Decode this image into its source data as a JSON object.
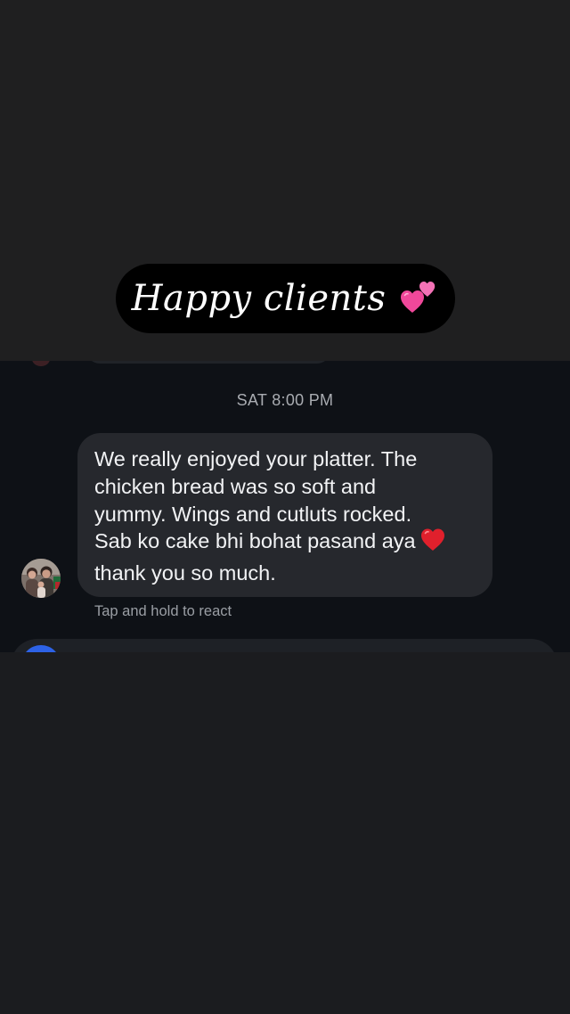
{
  "story": {
    "caption": "Happy clients",
    "caption_emoji": "two-hearts",
    "caption_bg": "#000000",
    "caption_color": "#ffffff"
  },
  "chat": {
    "timestamp": "SAT 8:00 PM",
    "message": {
      "lines": [
        "We really enjoyed your platter. The",
        "chicken bread was so soft and",
        "yummy. Wings and cutluts rocked.",
        "Sab ko cake bhi bohat pasand aya",
        "thank you so much."
      ],
      "inline_emoji": "red-heart"
    },
    "react_hint": "Tap and hold to react",
    "bubble_color": "#26282d",
    "background_color": "#0e1116"
  }
}
